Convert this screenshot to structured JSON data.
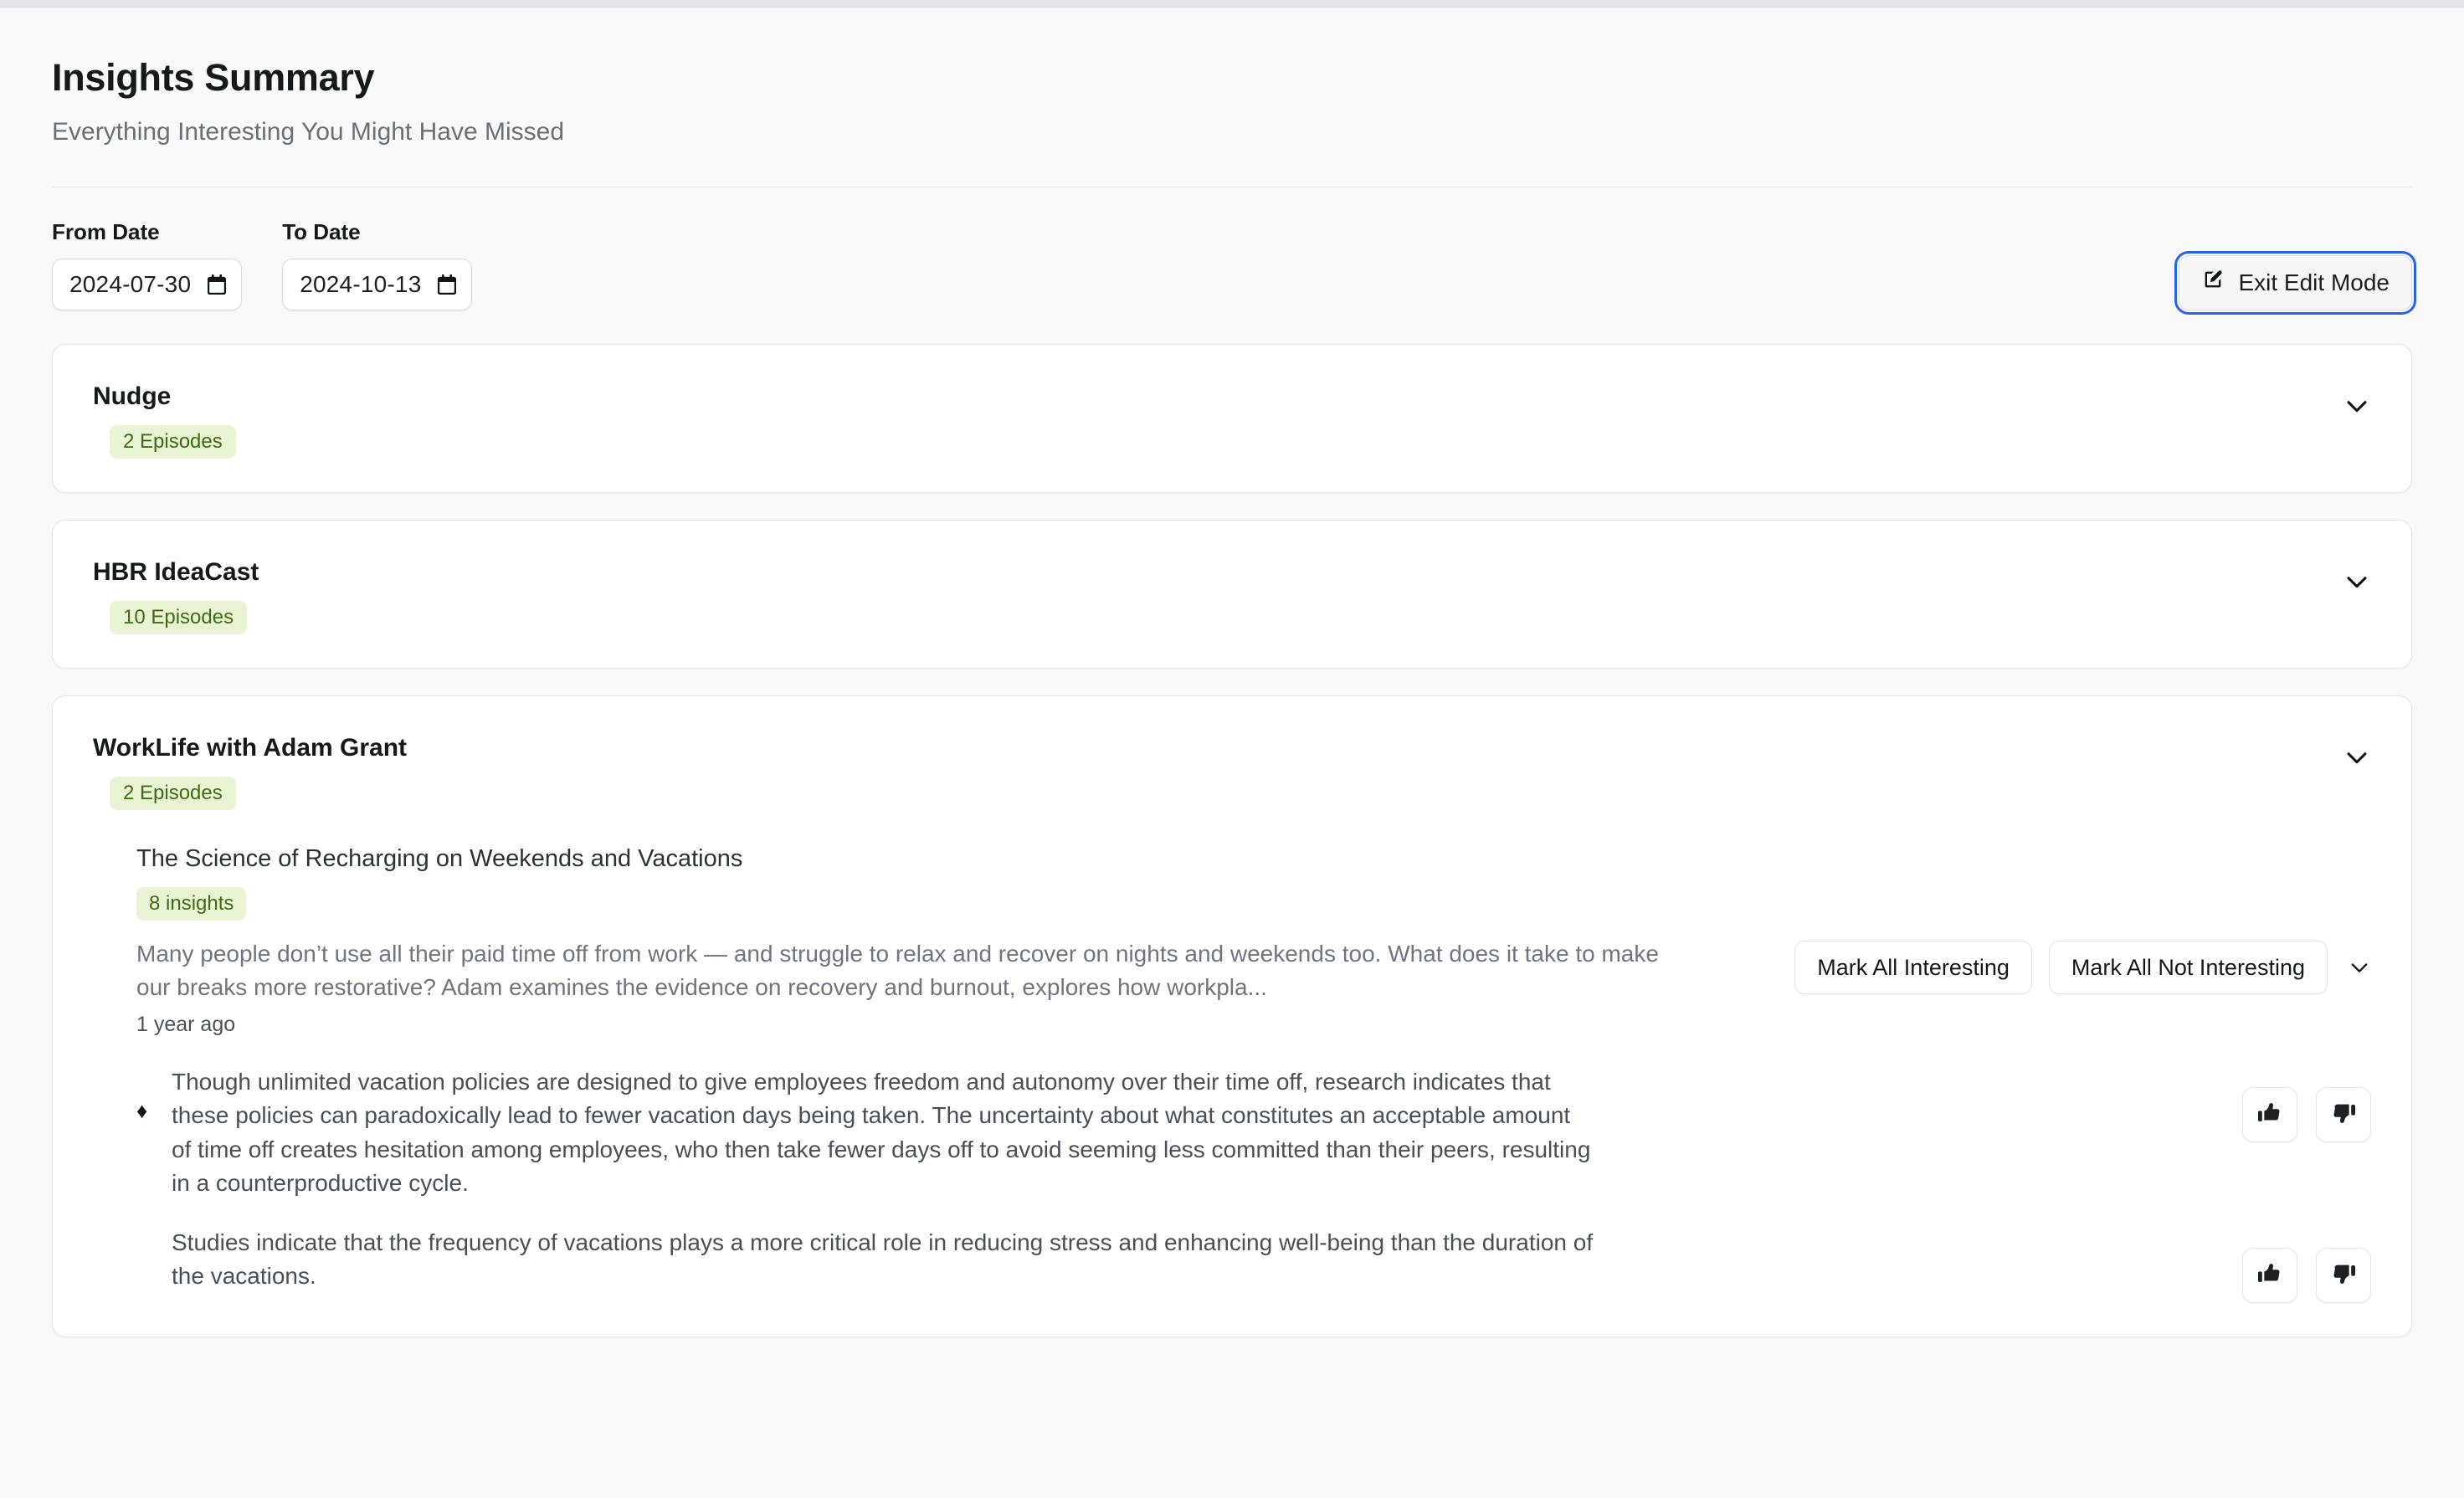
{
  "header": {
    "title": "Insights Summary",
    "subtitle": "Everything Interesting You Might Have Missed"
  },
  "filters": {
    "from_label": "From Date",
    "from_value": "2024-07-30",
    "to_label": "To Date",
    "to_value": "2024-10-13",
    "edit_mode_button": "Exit Edit Mode"
  },
  "colors": {
    "page_bg": "#f9f9fa",
    "card_bg": "#ffffff",
    "badge_bg": "#e8f4d4",
    "badge_text": "#3f6b12",
    "focus_ring": "#2563eb"
  },
  "podcasts": [
    {
      "title": "Nudge",
      "episode_count_label": "2 Episodes",
      "expanded": false
    },
    {
      "title": "HBR IdeaCast",
      "episode_count_label": "10 Episodes",
      "expanded": false
    },
    {
      "title": "WorkLife with Adam Grant",
      "episode_count_label": "2 Episodes",
      "expanded": true,
      "episode": {
        "title": "The Science of Recharging on Weekends and Vacations",
        "insight_count_label": "8 insights",
        "description": "Many people don’t use all their paid time off from work — and struggle to relax and recover on nights and weekends too. What does it take to make our breaks more restorative? Adam examines the evidence on recovery and burnout, explores how workpla...",
        "age": "1 year ago",
        "mark_all_interesting": "Mark All Interesting",
        "mark_all_not_interesting": "Mark All Not Interesting",
        "insights": [
          {
            "bullet": "♦",
            "text": "Though unlimited vacation policies are designed to give employees freedom and autonomy over their time off, research indicates that these policies can paradoxically lead to fewer vacation days being taken. The uncertainty about what constitutes an acceptable amount of time off creates hesitation among employees, who then take fewer days off to avoid seeming less committed than their peers, resulting in a counterproductive cycle."
          },
          {
            "bullet": "",
            "text": "Studies indicate that the frequency of vacations plays a more critical role in reducing stress and enhancing well-being than the duration of the vacations."
          }
        ]
      }
    }
  ]
}
